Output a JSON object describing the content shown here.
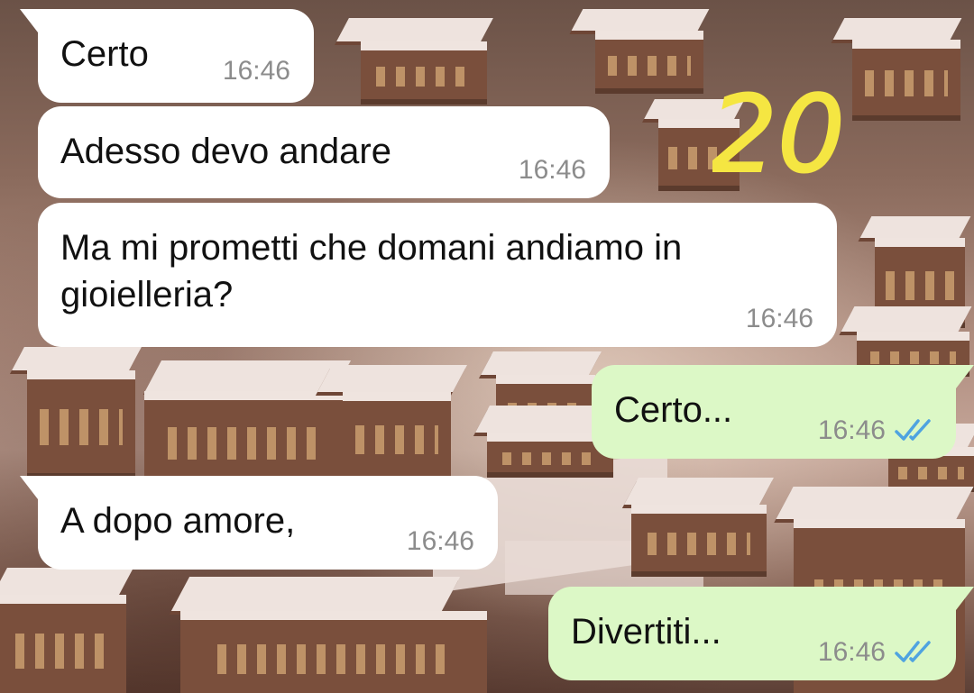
{
  "overlay": {
    "number": "20",
    "color": "#f5e642"
  },
  "colors": {
    "incoming": "#ffffff",
    "outgoing": "#dcf8c6",
    "read_ticks": "#4fa3e0",
    "time": "#8c8c8c"
  },
  "messages": [
    {
      "direction": "incoming",
      "text": "Certo",
      "time": "16:46"
    },
    {
      "direction": "incoming",
      "text": "Adesso devo andare",
      "time": "16:46"
    },
    {
      "direction": "incoming",
      "text": "Ma mi prometti che domani andiamo in\ngioielleria?",
      "time": "16:46"
    },
    {
      "direction": "outgoing",
      "text": "Certo...",
      "time": "16:46",
      "status": "read-double-check-icon"
    },
    {
      "direction": "incoming",
      "text": "A dopo amore,",
      "time": "16:46"
    },
    {
      "direction": "outgoing",
      "text": "Divertiti...",
      "time": "16:46",
      "status": "read-double-check-icon"
    }
  ]
}
